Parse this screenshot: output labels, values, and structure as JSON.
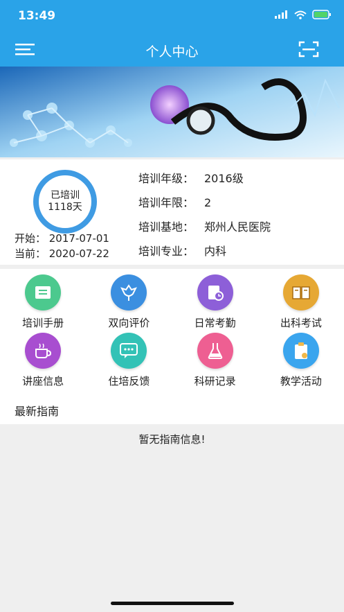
{
  "status": {
    "time": "13:49"
  },
  "nav": {
    "title": "个人中心"
  },
  "trained": {
    "label": "已培训",
    "days": "1118天"
  },
  "dates": {
    "start": "开始：  2017-07-01",
    "current": "当前：  2020-07-22"
  },
  "fields": [
    {
      "key": "培训年级：",
      "value": "2016级"
    },
    {
      "key": "培训年限：",
      "value": "2"
    },
    {
      "key": "培训基地：",
      "value": "郑州人民医院"
    },
    {
      "key": "培训专业：",
      "value": "内科"
    }
  ],
  "menu": [
    {
      "label": "培训手册",
      "icon": "handbook-icon",
      "color": "#4cc98e"
    },
    {
      "label": "双向评价",
      "icon": "flower-icon",
      "color": "#3b8fe0"
    },
    {
      "label": "日常考勤",
      "icon": "attendance-icon",
      "color": "#8d5fd8"
    },
    {
      "label": "出科考试",
      "icon": "exam-book-icon",
      "color": "#e6a834"
    },
    {
      "label": "讲座信息",
      "icon": "coffee-cup-icon",
      "color": "#a84ed0"
    },
    {
      "label": "住培反馈",
      "icon": "chat-bubble-icon",
      "color": "#33c2b6"
    },
    {
      "label": "科研记录",
      "icon": "flask-icon",
      "color": "#ee5f92"
    },
    {
      "label": "教学活动",
      "icon": "clipboard-icon",
      "color": "#3aa5ee"
    }
  ],
  "guide": {
    "title": "最新指南",
    "empty": "暂无指南信息!"
  }
}
